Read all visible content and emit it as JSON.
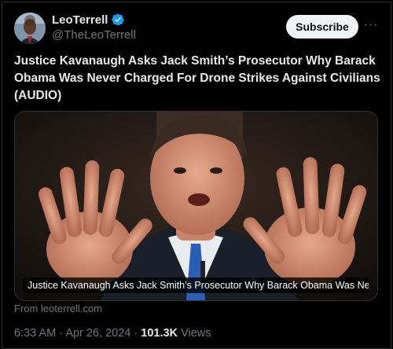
{
  "author": {
    "name": "LeoTerrell",
    "handle": "@TheLeoTerrell",
    "verified_icon": "verified-badge-icon"
  },
  "actions": {
    "subscribe_label": "Subscribe",
    "more_label": "···"
  },
  "post": {
    "text": "Justice Kavanaugh Asks Jack Smith’s Prosecutor Why Barack Obama Was Never Charged For Drone Strikes Against Civilians (AUDIO)"
  },
  "link_card": {
    "caption": "Justice Kavanaugh Asks Jack Smith’s Prosecutor Why Barack Obama Was Never ...",
    "source": "From leoterrell.com"
  },
  "meta": {
    "time": "6:33 AM",
    "separator1": "·",
    "date": "Apr 26, 2024",
    "separator2": "·",
    "views_count": "101.3K",
    "views_label": "Views"
  },
  "colors": {
    "background": "#000000",
    "text": "#e7e9ea",
    "muted": "#71767b",
    "verified": "#1d9bf0"
  }
}
